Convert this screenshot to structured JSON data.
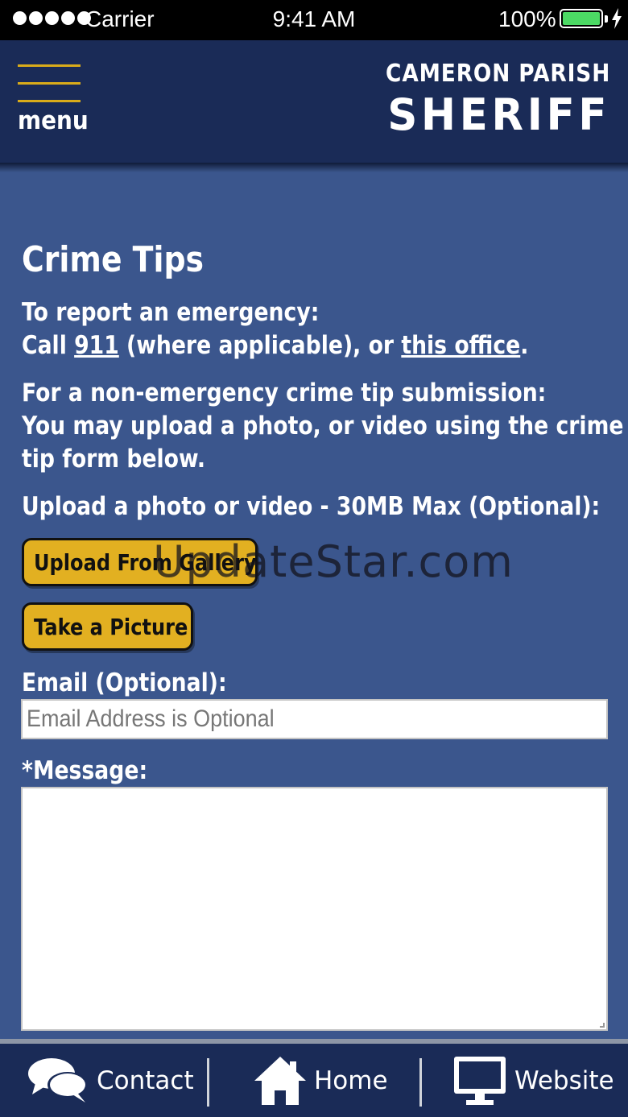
{
  "status_bar": {
    "carrier": "Carrier",
    "time": "9:41 AM",
    "battery_percent": "100%",
    "battery_level": 1.0,
    "battery_color": "#4cd964"
  },
  "header": {
    "menu_label": "menu",
    "brand_line1": "CAMERON PARISH",
    "brand_line2": "SHERIFF",
    "accent_color": "#d9ac1a"
  },
  "main": {
    "title": "Crime Tips",
    "emergency_heading": "To report an emergency:",
    "emergency_call_prefix": "Call ",
    "emergency_911_link": "911",
    "emergency_middle": " (where applicable), or ",
    "emergency_office_link": "this office",
    "emergency_suffix": ".",
    "nonemergency_line1": "For a non-emergency crime tip submission:",
    "nonemergency_line2": "You may upload a photo, or video using the crime",
    "nonemergency_line3": "tip form below.",
    "upload_label": "Upload a photo or video - 30MB Max (Optional):",
    "upload_gallery_button": "Upload From Gallery",
    "take_picture_button": "Take a Picture",
    "email_label": "Email (Optional):",
    "email_placeholder": "Email Address is Optional",
    "email_value": "",
    "message_label": "*Message:",
    "message_value": ""
  },
  "watermark": "UpdateStar.com",
  "bottom_nav": {
    "items": [
      {
        "label": "Contact",
        "icon": "chat-bubbles-icon"
      },
      {
        "label": "Home",
        "icon": "home-icon"
      },
      {
        "label": "Website",
        "icon": "monitor-icon"
      }
    ]
  },
  "colors": {
    "background": "#3b568d",
    "header": "#1a2b57",
    "button": "#e2b021"
  }
}
